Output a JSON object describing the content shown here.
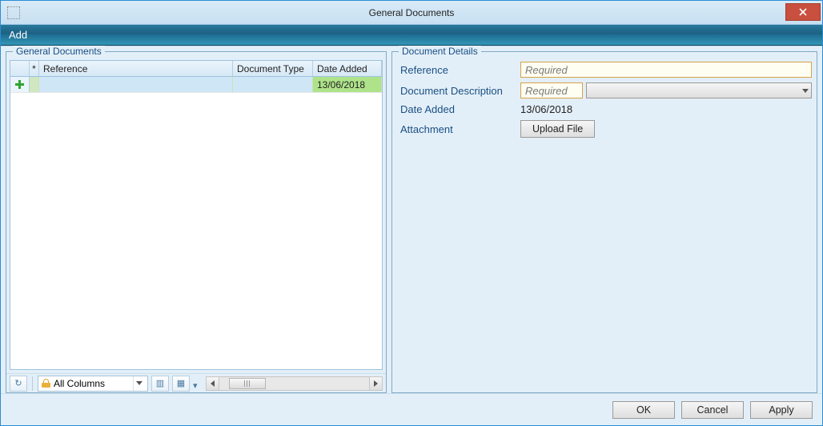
{
  "window": {
    "title": "General Documents"
  },
  "menubar": {
    "add": "Add"
  },
  "left": {
    "legend": "General Documents",
    "columns": {
      "star": "*",
      "reference": "Reference",
      "doctype": "Document Type",
      "dateadded": "Date Added"
    },
    "row": {
      "reference": "",
      "doctype": "",
      "dateadded": "13/06/2018"
    },
    "footer": {
      "combo_label": "All Columns"
    }
  },
  "right": {
    "legend": "Document Details",
    "labels": {
      "reference": "Reference",
      "desc": "Document Description",
      "date": "Date Added",
      "attach": "Attachment"
    },
    "placeholders": {
      "reference": "Required",
      "desc": "Required"
    },
    "date_value": "13/06/2018",
    "upload_label": "Upload File"
  },
  "buttons": {
    "ok": "OK",
    "cancel": "Cancel",
    "apply": "Apply"
  }
}
